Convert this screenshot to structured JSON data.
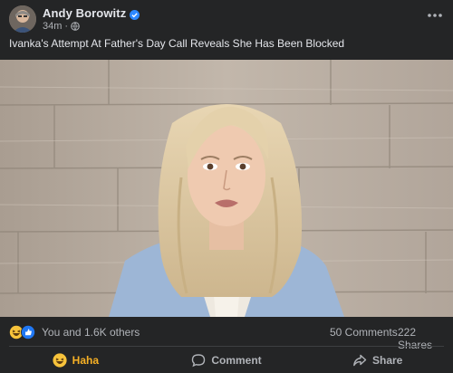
{
  "author": {
    "name": "Andy Borowitz",
    "time": "34m",
    "meta_separator": "·"
  },
  "caption": "Ivanka's Attempt At Father's Day Call Reveals She Has Been Blocked",
  "stats": {
    "reactions_text": "You and 1.6K others",
    "comments": "50 Comments",
    "shares": "222 Shares"
  },
  "actions": {
    "haha_label": "Haha",
    "comment_label": "Comment",
    "share_label": "Share"
  },
  "colors": {
    "background": "#242526",
    "primary_text": "#e4e6eb",
    "secondary_text": "#b0b3b8",
    "haha_accent": "#f7b125",
    "verified_blue": "#2d88ff",
    "like_blue": "#2078f4"
  },
  "icons": [
    "verified-badge-icon",
    "globe-icon",
    "more-options-icon",
    "haha-reaction-icon",
    "like-reaction-icon",
    "comment-icon",
    "share-icon"
  ]
}
